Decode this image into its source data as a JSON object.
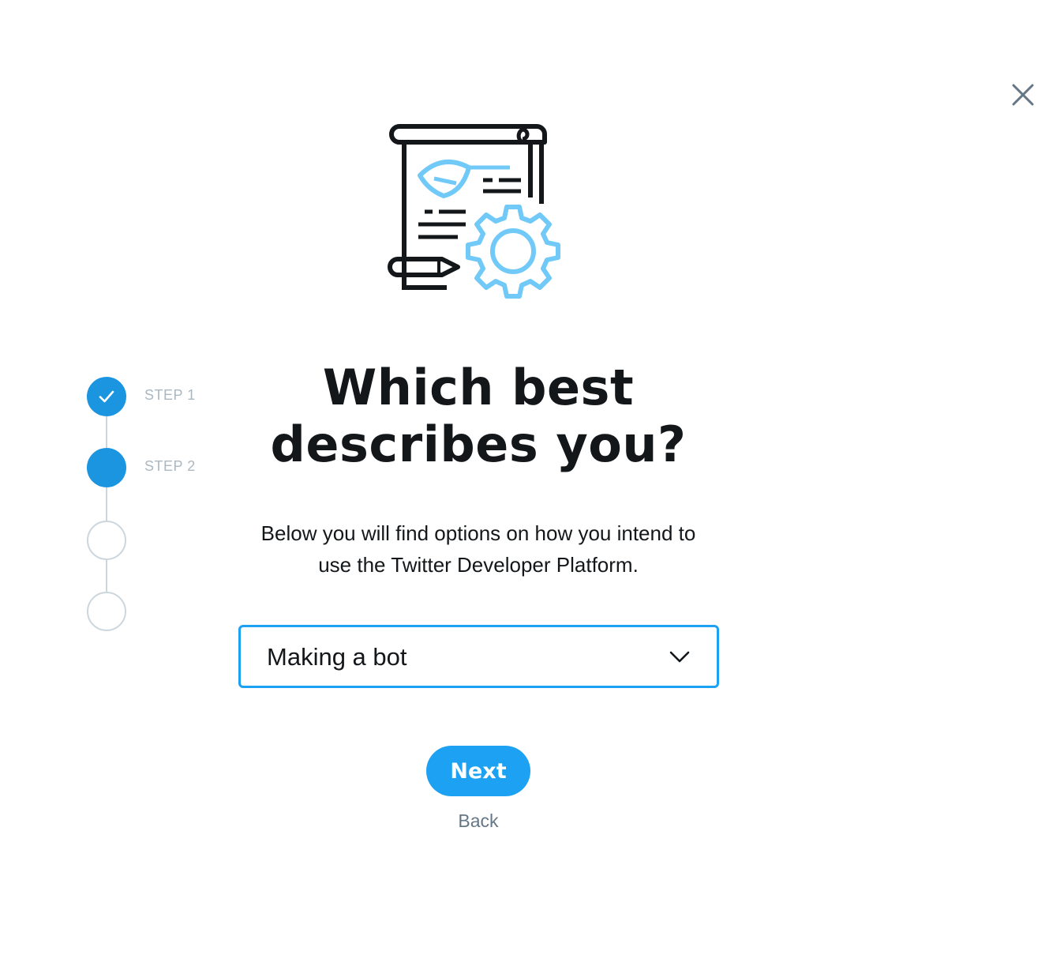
{
  "dialog": {
    "close_icon": "close-icon",
    "illustration_icon": "scroll-with-gear-icon",
    "title_line1": "Which best",
    "title_line2": "describes you?",
    "subtitle_line1": "Below you will find options on how you intend to",
    "subtitle_line2": "use the Twitter Developer Platform.",
    "select": {
      "selected_value": "Making a bot",
      "icon": "chevron-down-icon"
    },
    "next_label": "Next",
    "back_label": "Back"
  },
  "stepper": {
    "steps": [
      {
        "label": "STEP 1",
        "state": "done",
        "icon": "checkmark-icon"
      },
      {
        "label": "STEP 2",
        "state": "active"
      },
      {
        "label": "",
        "state": "pending"
      },
      {
        "label": "",
        "state": "pending"
      }
    ]
  },
  "colors": {
    "accent": "#1da1f2",
    "step_active": "#1b95e0",
    "illustration_dark": "#14171a",
    "illustration_light": "#71c9f8",
    "muted_text": "#aab8c2",
    "secondary_text": "#657786"
  }
}
